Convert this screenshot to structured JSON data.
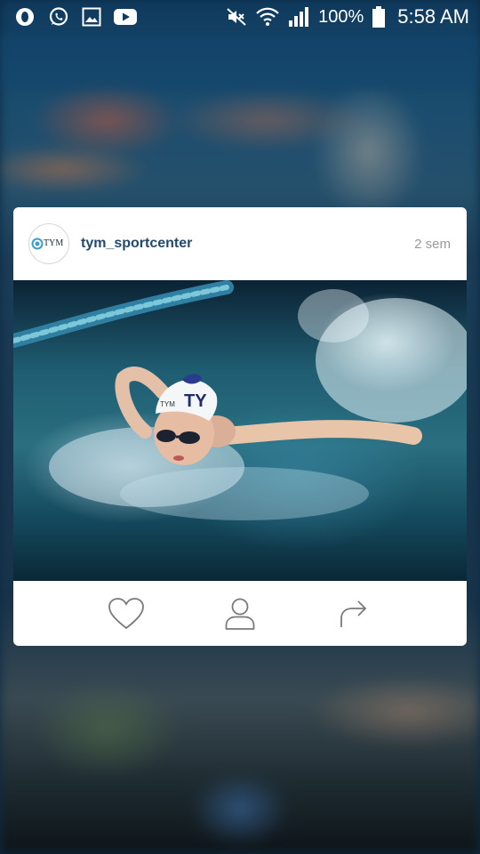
{
  "status_bar": {
    "left_icons": [
      "opera-icon",
      "whatsapp-icon",
      "gallery-icon",
      "youtube-icon"
    ],
    "right_icons": [
      "mute-icon",
      "wifi-icon",
      "signal-icon",
      "battery-icon"
    ],
    "battery": "100%",
    "time": "5:58 AM"
  },
  "post": {
    "avatar_text": "TYM",
    "username": "tym_sportcenter",
    "time_ago": "2 sem",
    "photo_alt": "swimmer",
    "cap_text": "TY",
    "cap_small_text": "TYM"
  },
  "actions": {
    "like_icon": "heart-icon",
    "profile_icon": "person-icon",
    "share_icon": "share-arrow-icon"
  },
  "colors": {
    "username": "#234a6e",
    "time_ago": "#999999",
    "icons": "#7a7a7a"
  }
}
